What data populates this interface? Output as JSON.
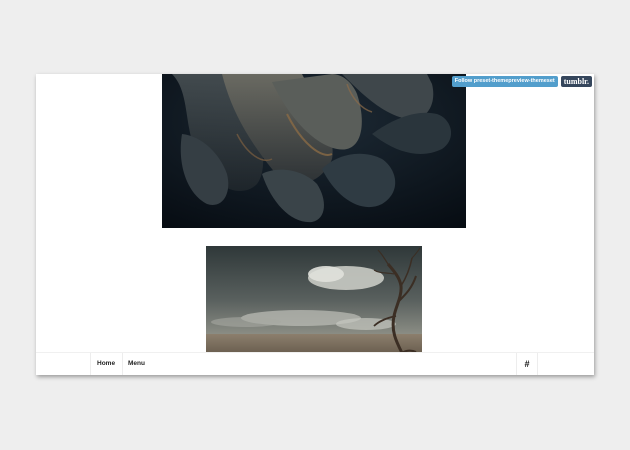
{
  "tumblr_bar": {
    "follow_label": "Follow preset-themepreview-themeset",
    "logo_label": "tumblr."
  },
  "posts": [
    {
      "type": "photo",
      "subject": "dried flower close-up"
    },
    {
      "type": "photo",
      "subject": "dead tree in desert under clouds"
    }
  ],
  "nav": {
    "items": [
      {
        "label": "Home"
      },
      {
        "label": "Menu"
      }
    ],
    "hash_label": "#"
  },
  "colors": {
    "background": "#eeeeee",
    "page": "#ffffff",
    "follow_button": "#529ecc",
    "tumblr_button": "#35465c"
  }
}
